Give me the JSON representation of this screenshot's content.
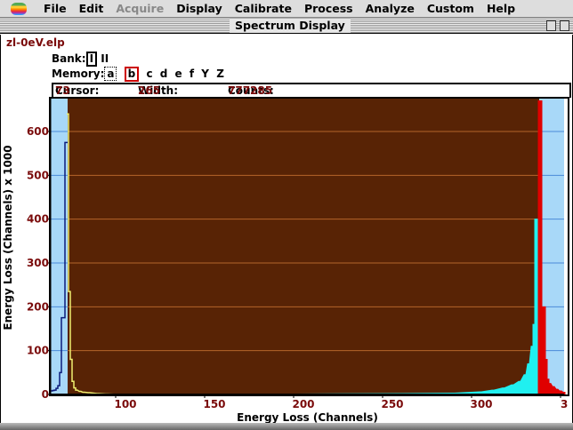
{
  "menubar": {
    "items": [
      {
        "label": "File",
        "enabled": true
      },
      {
        "label": "Edit",
        "enabled": true
      },
      {
        "label": "Acquire",
        "enabled": false
      },
      {
        "label": "Display",
        "enabled": true
      },
      {
        "label": "Calibrate",
        "enabled": true
      },
      {
        "label": "Process",
        "enabled": true
      },
      {
        "label": "Analyze",
        "enabled": true
      },
      {
        "label": "Custom",
        "enabled": true
      },
      {
        "label": "Help",
        "enabled": true
      }
    ]
  },
  "window": {
    "title": "Spectrum Display"
  },
  "file_name": "zl-0eV.elp",
  "bank": {
    "label": "Bank:",
    "options": [
      "I",
      "II"
    ],
    "selected": "I"
  },
  "memory": {
    "label": "Memory:",
    "options": [
      "a",
      "b",
      "c",
      "d",
      "e",
      "f",
      "Y",
      "Z"
    ],
    "selected": "b",
    "focused": "a"
  },
  "info": {
    "cursor_label": "Cursor:",
    "cursor": "73",
    "width_label": "Width:",
    "width": "265",
    "counts_label": "Counts:",
    "counts": "777285"
  },
  "toolbar_icons": [
    "expand-horizontal-icon",
    "compress-horizontal-icon",
    "expand-vertical-icon",
    "compress-vertical-icon",
    "arrow-left-icon",
    "arrow-right-icon",
    "arrow-down-icon",
    "arrow-up-icon",
    "baseline-zero-icon",
    "move-icon",
    "window-icon",
    "home-icon"
  ],
  "chart_data": {
    "type": "line",
    "xlabel": "Energy Loss (Channels)",
    "ylabel": "Energy Loss (Channels) x 1000",
    "xlim": [
      63.5,
      352
    ],
    "ylim": [
      0,
      675
    ],
    "xticks": [
      100,
      150,
      200,
      250,
      300,
      350
    ],
    "xtick_labels": [
      "100",
      "150",
      "200",
      "250",
      "300",
      "3"
    ],
    "yticks": [
      0,
      100,
      200,
      300,
      400,
      500,
      600
    ],
    "ytick_labels": [
      "0",
      "100",
      "200",
      "300",
      "400",
      "500",
      "600"
    ],
    "grid": true,
    "colors": {
      "background": "#582305",
      "outside": "#a8d8f8",
      "grid_inside": "#b5652a",
      "grid_outside": "#4a8ad8",
      "axis_labels": "#7a0a0a"
    },
    "selection": {
      "start": 73,
      "end": 338
    },
    "series": [
      {
        "color": "#0a1a7a",
        "fill": false,
        "points": [
          [
            64,
            8
          ],
          [
            65,
            9
          ],
          [
            66,
            10
          ],
          [
            67,
            14
          ],
          [
            68,
            20
          ],
          [
            69,
            50
          ],
          [
            70,
            175
          ],
          [
            71,
            175
          ],
          [
            72,
            575
          ],
          [
            73,
            575
          ]
        ]
      },
      {
        "color": "#f0f070",
        "fill": false,
        "points": [
          [
            73,
            640
          ],
          [
            74,
            235
          ],
          [
            75,
            80
          ],
          [
            76,
            30
          ],
          [
            77,
            15
          ],
          [
            78,
            10
          ],
          [
            80,
            7
          ],
          [
            82,
            5
          ],
          [
            85,
            4
          ],
          [
            90,
            2
          ],
          [
            95,
            1
          ],
          [
            100,
            0.5
          ],
          [
            110,
            0
          ]
        ]
      },
      {
        "color": "#20f0f0",
        "fill": true,
        "points": [
          [
            75,
            0.5
          ],
          [
            200,
            1
          ],
          [
            260,
            2
          ],
          [
            290,
            3
          ],
          [
            305,
            6
          ],
          [
            312,
            10
          ],
          [
            318,
            15
          ],
          [
            323,
            22
          ],
          [
            327,
            30
          ],
          [
            330,
            45
          ],
          [
            332,
            70
          ],
          [
            334,
            110
          ],
          [
            335,
            160
          ],
          [
            336,
            400
          ],
          [
            337,
            400
          ]
        ]
      },
      {
        "color": "#e00000",
        "fill": true,
        "points": [
          [
            338,
            670
          ],
          [
            339,
            670
          ],
          [
            340,
            200
          ],
          [
            341,
            200
          ],
          [
            342,
            80
          ],
          [
            343,
            35
          ],
          [
            344,
            25
          ],
          [
            346,
            18
          ],
          [
            348,
            12
          ],
          [
            350,
            8
          ],
          [
            352,
            5
          ]
        ]
      }
    ]
  }
}
